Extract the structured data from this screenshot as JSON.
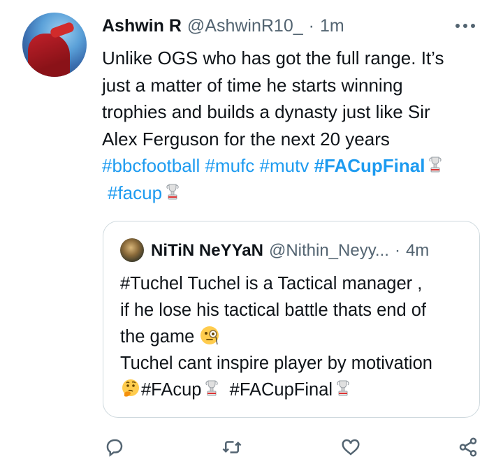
{
  "tweet": {
    "author_name": "Ashwin R",
    "author_handle": "@AshwinR10_",
    "separator": "·",
    "time": "1m",
    "lines": [
      "Unlike OGS who has got the full range. It’s",
      "just a matter of time he starts winning",
      "trophies and builds a dynasty just like Sir",
      "Alex Ferguson for the next 20 years"
    ],
    "hashtags": [
      "#bbcfootball",
      "#mufc",
      "#mutv",
      "#FACupFinal",
      "#facup"
    ]
  },
  "quoted": {
    "author_name": "NiTiN NeYYaN",
    "author_handle": "@Nithin_Neyy...",
    "separator": "·",
    "time": "4m",
    "line1": "#Tuchel Tuchel is a Tactical manager ,",
    "line2": "if he lose his tactical battle thats end of",
    "line3": "the game",
    "line4": "Tuchel cant inspire player by motivation",
    "hashtag1": "#FAcup",
    "hashtag2": "#FACupFinal",
    "emojis": [
      "monocle-face",
      "thinking-face"
    ]
  },
  "actions": [
    "reply",
    "retweet",
    "like",
    "share"
  ],
  "colors": {
    "link": "#1d9bf0",
    "text": "#0f1419",
    "secondary": "#536471",
    "border": "#cfd9de"
  }
}
